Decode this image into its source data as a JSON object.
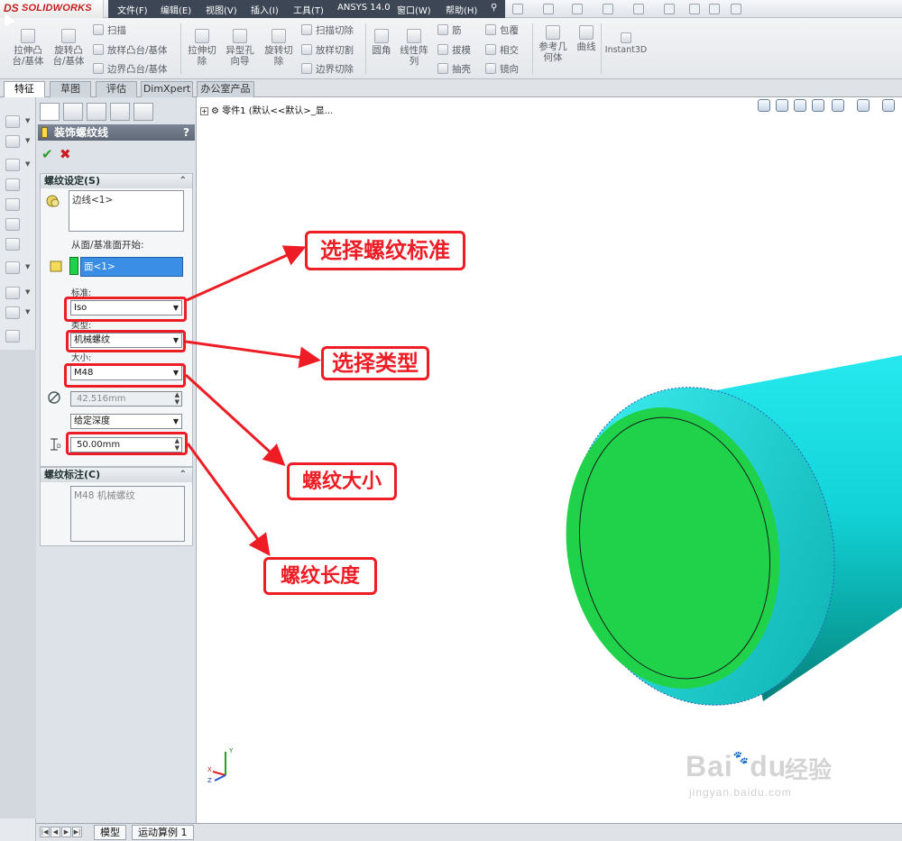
{
  "app": {
    "brand_ds": "DS",
    "brand_name": "SOLIDWORKS",
    "menu": [
      "文件(F)",
      "编辑(E)",
      "视图(V)",
      "插入(I)",
      "工具(T)",
      "ANSYS 14.0",
      "窗口(W)",
      "帮助(H)"
    ]
  },
  "ribbon": {
    "extrude_boss": [
      "拉伸凸",
      "台/基体"
    ],
    "revolve_boss": [
      "旋转凸",
      "台/基体"
    ],
    "sweep": "扫描",
    "loft": "放样凸台/基体",
    "boundary_boss": "边界凸台/基体",
    "extrude_cut": [
      "拉伸切",
      "除"
    ],
    "hole_wizard": [
      "异型孔",
      "向导"
    ],
    "revolve_cut": [
      "旋转切",
      "除"
    ],
    "swept_cut": "扫描切除",
    "lofted_cut": "放样切割",
    "boundary_cut": "边界切除",
    "fillet": "圆角",
    "linear_pattern": [
      "线性阵",
      "列"
    ],
    "rib": "筋",
    "draft": "拔模",
    "shell": "抽壳",
    "wrap": "包覆",
    "intersect": "相交",
    "mirror": "镜向",
    "ref_geometry": [
      "参考几",
      "何体"
    ],
    "curves": "曲线",
    "instant3d": "Instant3D"
  },
  "tabs": [
    "特征",
    "草图",
    "评估",
    "DimXpert",
    "办公室产品"
  ],
  "property_manager": {
    "title": "装饰螺纹线",
    "help": "?",
    "ok_symbol": "✔",
    "cancel_symbol": "✖",
    "thread_settings": {
      "heading": "螺纹设定(S)",
      "edge": "边线<1>",
      "start_label": "从面/基准面开始:",
      "start_face": "面<1>",
      "standard_label": "标准:",
      "standard": "Iso",
      "type_label": "类型:",
      "type": "机械螺纹",
      "size_label": "大小:",
      "size": "M48",
      "diameter": "42.516mm",
      "end_condition": "给定深度",
      "depth": "50.00mm"
    },
    "callout_group": {
      "heading": "螺纹标注(C)",
      "text": "M48 机械螺纹"
    }
  },
  "graphics": {
    "tree_text": "零件1  (默认<<默认>_显...",
    "triad": {
      "x": "X",
      "y": "Y",
      "z": "Z"
    },
    "part_colors": {
      "cylinder": "#19e3e8",
      "face": "#1fd24a",
      "edge": "#1a1a1a"
    }
  },
  "annotations": {
    "select_standard": "选择螺纹标准",
    "select_type": "选择类型",
    "thread_size": "螺纹大小",
    "thread_length": "螺纹长度",
    "color": "#ee1c24"
  },
  "watermark": {
    "brand": "Bai",
    "mid": "du",
    "cn": "经验",
    "url": "jingyan.baidu.com"
  },
  "bottom_tabs": [
    "模型",
    "运动算例 1"
  ]
}
